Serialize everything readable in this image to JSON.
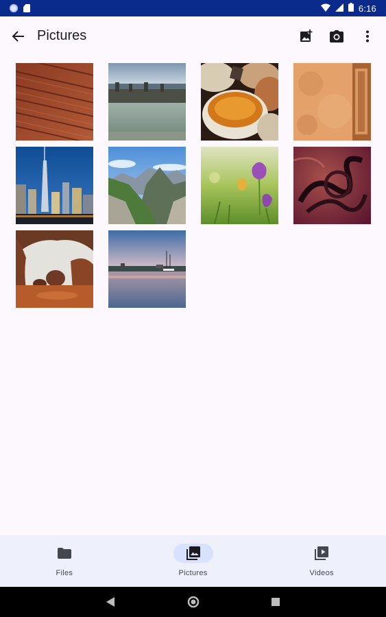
{
  "status_bar": {
    "time": "6:16"
  },
  "app_bar": {
    "title": "Pictures"
  },
  "grid": {
    "items": [
      {
        "name": "wood-deck-photo"
      },
      {
        "name": "sea-pool-photo"
      },
      {
        "name": "spice-bowls-photo"
      },
      {
        "name": "orange-wall-photo"
      },
      {
        "name": "city-skyline-photo"
      },
      {
        "name": "mountain-valley-photo"
      },
      {
        "name": "crocus-flower-photo"
      },
      {
        "name": "abstract-swirl-photo"
      },
      {
        "name": "rock-cave-photo"
      },
      {
        "name": "harbor-sunset-photo"
      }
    ]
  },
  "bottom_nav": {
    "items": [
      {
        "label": "Files",
        "icon": "folder-icon",
        "active": false
      },
      {
        "label": "Pictures",
        "icon": "photo-library-icon",
        "active": true
      },
      {
        "label": "Videos",
        "icon": "video-library-icon",
        "active": false
      }
    ]
  },
  "colors": {
    "status_bar": "#0a2a8c",
    "background": "#fcf8fd",
    "nav_bar": "#eef0fb",
    "nav_active_pill": "#d8e2ff",
    "icon": "#1c1b1f"
  }
}
